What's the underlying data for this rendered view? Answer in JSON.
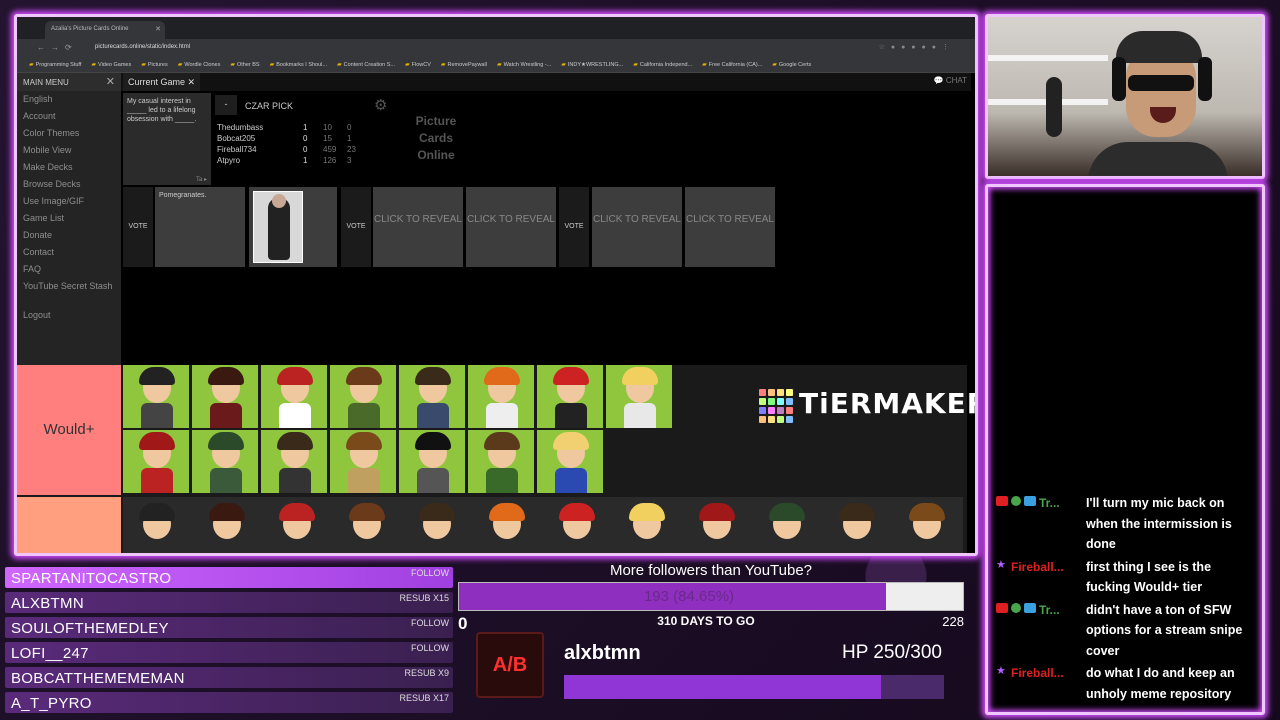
{
  "browser": {
    "tab_title": "Azalia's Picture Cards Online",
    "url": "picturecards.online/static/index.html",
    "bookmarks": [
      "Programming Stuff",
      "Video Games",
      "Pictures",
      "Wordle Clones",
      "Other BS",
      "Bookmarks I Shoul...",
      "Content Creation S...",
      "FlowCV",
      "RemovePaywall",
      "Watch Wrestling -...",
      "INDY★WRESTLING...",
      "California Independ...",
      "Free California (CA)...",
      "Google Certs"
    ]
  },
  "sidebar": {
    "title": "MAIN MENU",
    "items": [
      "English",
      "Account",
      "Color Themes",
      "Mobile View",
      "Make Decks",
      "Browse Decks",
      "Use Image/GIF",
      "Game List",
      "Donate",
      "Contact",
      "FAQ",
      "YouTube Secret Stash",
      "Logout"
    ]
  },
  "game": {
    "tab_label": "Current Game",
    "chat_label": "CHAT",
    "prompt": "My casual interest in _____ led to a lifelong obsession with _____.",
    "prompt_corner": "Ta",
    "minus_label": "-",
    "czar_label": "CZAR PICK",
    "players": [
      {
        "name": "Thedumbass",
        "c1": "1",
        "c2": "10",
        "c3": "0"
      },
      {
        "name": "Bobcat205",
        "c1": "0",
        "c2": "15",
        "c3": "1"
      },
      {
        "name": "Fireball734",
        "c1": "0",
        "c2": "459",
        "c3": "23"
      },
      {
        "name": "Atpyro",
        "c1": "1",
        "c2": "126",
        "c3": "3"
      }
    ],
    "pco_label": "Picture Cards Online",
    "vote_label": "VOTE",
    "answer_text": "Pomegranates.",
    "reveal_label": "CLICK TO REVEAL"
  },
  "tiermaker": {
    "tier_label": "Would+",
    "logo_text": "TiERMAKER"
  },
  "chat": {
    "messages": [
      {
        "user": "Tr...",
        "color": "#49a64b",
        "text": "I'll turn my mic back on when the intermission is done"
      },
      {
        "user": "Fireball...",
        "color": "#e02020",
        "text": "first thing I see is the fucking Would+ tier"
      },
      {
        "user": "Tr...",
        "color": "#49a64b",
        "text": "didn't have a ton of SFW options for a stream snipe cover"
      },
      {
        "user": "Fireball...",
        "color": "#e02020",
        "text": "do what I do and keep an unholy meme repository"
      }
    ]
  },
  "events": [
    {
      "name": "SPARTANITOCASTRO",
      "type": "FOLLOW"
    },
    {
      "name": "ALXBTMN",
      "type": "RESUB X15"
    },
    {
      "name": "SOULOFTHEMEDLEY",
      "type": "FOLLOW"
    },
    {
      "name": "LOFI__247",
      "type": "FOLLOW"
    },
    {
      "name": "BOBCATTHEMEMEMAN",
      "type": "RESUB X9"
    },
    {
      "name": "A_T_PYRO",
      "type": "RESUB X17"
    }
  ],
  "goal": {
    "title": "More followers than YouTube?",
    "progress_text": "193 (84.65%)",
    "progress": 0.8465,
    "start": "0",
    "days": "310 DAYS TO GO",
    "end": "228"
  },
  "hp": {
    "logo": "A/B",
    "name": "alxbtmn",
    "value_text": "HP 250/300",
    "fraction": 0.8333
  }
}
